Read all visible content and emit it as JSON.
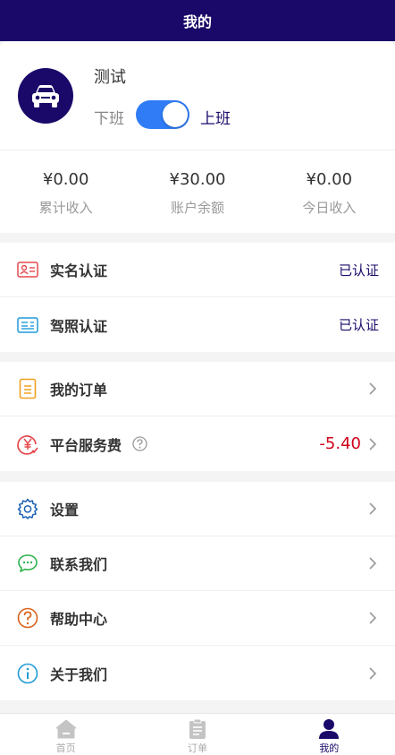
{
  "header": {
    "title": "我的"
  },
  "profile": {
    "name": "测试",
    "off_label": "下班",
    "on_label": "上班",
    "on_duty": true
  },
  "stats": [
    {
      "value": "¥0.00",
      "label": "累计收入"
    },
    {
      "value": "¥30.00",
      "label": "账户余额"
    },
    {
      "value": "¥0.00",
      "label": "今日收入"
    }
  ],
  "verification": [
    {
      "icon": "id-card-icon",
      "label": "实名认证",
      "status": "已认证"
    },
    {
      "icon": "driver-license-icon",
      "label": "驾照认证",
      "status": "已认证"
    }
  ],
  "orders": {
    "my_orders": "我的订单",
    "service_fee_label": "平台服务费",
    "service_fee_value": "-5.40"
  },
  "menu": [
    {
      "icon": "gear-icon",
      "label": "设置"
    },
    {
      "icon": "chat-icon",
      "label": "联系我们"
    },
    {
      "icon": "question-icon",
      "label": "帮助中心"
    },
    {
      "icon": "info-icon",
      "label": "关于我们"
    }
  ],
  "tabbar": [
    {
      "icon": "home-icon",
      "label": "首页",
      "active": false
    },
    {
      "icon": "clipboard-icon",
      "label": "订单",
      "active": false
    },
    {
      "icon": "user-icon",
      "label": "我的",
      "active": true
    }
  ],
  "colors": {
    "primary": "#1a0969",
    "toggle": "#2f7cf6",
    "fee": "#d0021b"
  }
}
